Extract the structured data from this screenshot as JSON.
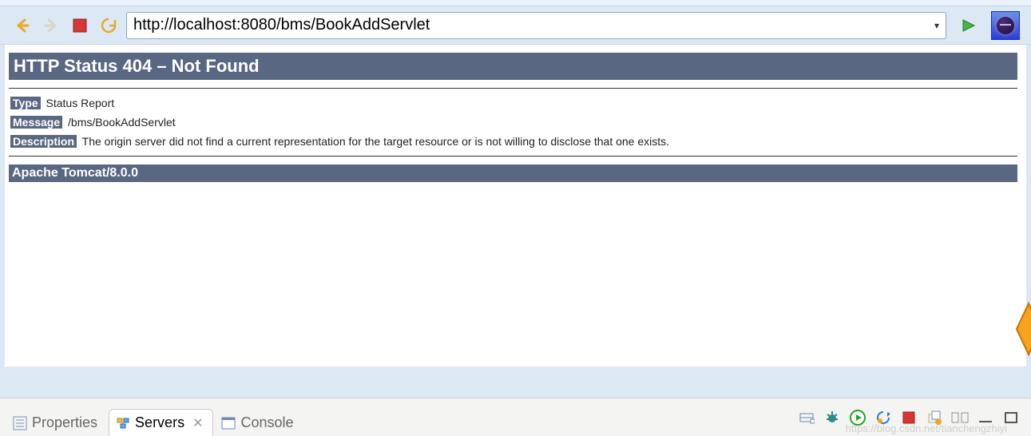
{
  "toolbar": {
    "url": "http://localhost:8080/bms/BookAddServlet"
  },
  "page": {
    "heading": "HTTP Status 404 – Not Found",
    "type_label": "Type",
    "type_value": "Status Report",
    "message_label": "Message",
    "message_value": "/bms/BookAddServlet",
    "description_label": "Description",
    "description_value": "The origin server did not find a current representation for the target resource or is not willing to disclose that one exists.",
    "server": "Apache Tomcat/8.0.0"
  },
  "bottom": {
    "tabs": {
      "properties": "Properties",
      "servers": "Servers",
      "console": "Console"
    }
  },
  "watermark": "https://blog.csdn.net/tianchengzhiyi"
}
